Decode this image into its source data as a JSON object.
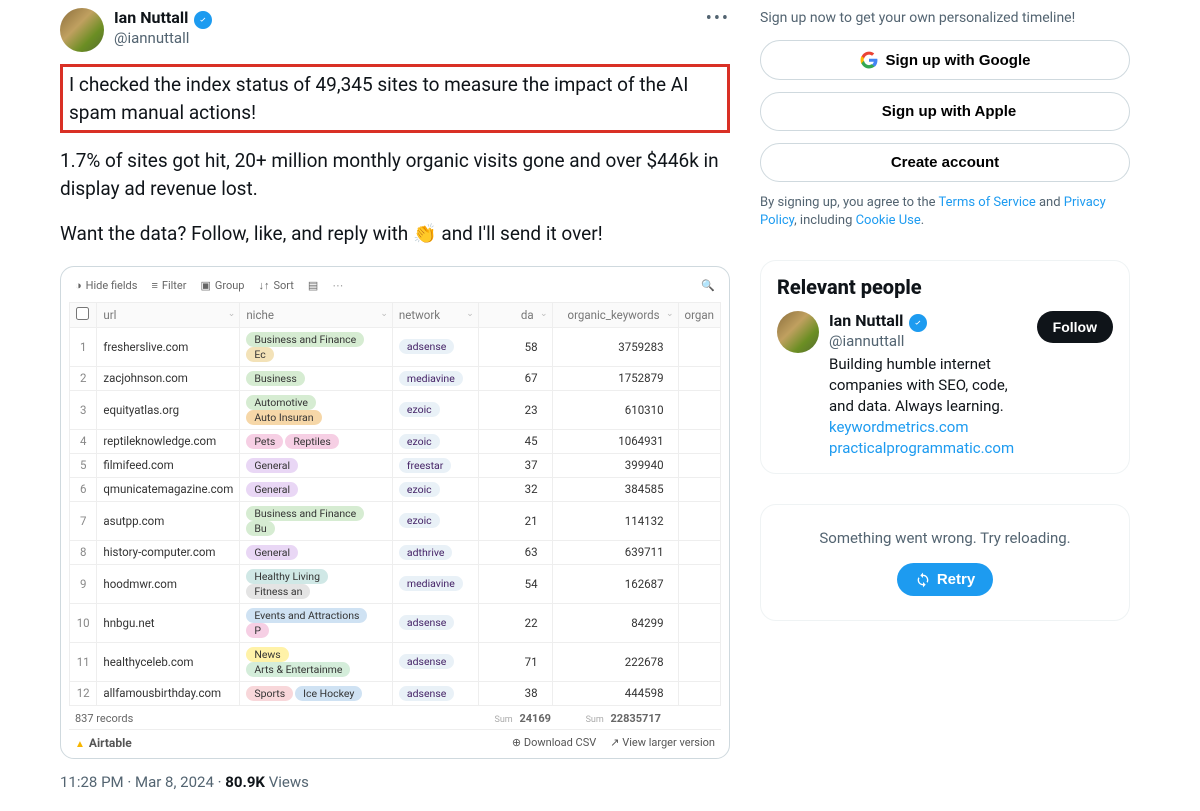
{
  "tweet": {
    "author": {
      "name": "Ian Nuttall",
      "handle": "@iannuttall"
    },
    "para1": "I checked the index status of 49,345 sites to measure the impact of the AI spam manual actions!",
    "para2": "1.7% of sites got hit, 20+ million monthly organic visits gone and over $446k in display ad revenue lost.",
    "para3_pre": "Want the data? Follow, like, and reply with ",
    "emoji": "👏",
    "para3_post": " and I'll send it over!",
    "timestamp": "11:28 PM · Mar 8, 2024",
    "views_count": "80.9K",
    "views_label": " Views"
  },
  "toolbar": {
    "hide": "Hide fields",
    "filter": "Filter",
    "group": "Group",
    "sort": "Sort"
  },
  "headers": {
    "url": "url",
    "niche": "niche",
    "network": "network",
    "da": "da",
    "organic_keywords": "organic_keywords",
    "organic": "organ"
  },
  "rows": [
    {
      "i": "1",
      "url": "fresherslive.com",
      "niches": [
        {
          "t": "Business and Finance",
          "c": "#d6ecd2"
        },
        {
          "t": "Ec",
          "c": "#f3e2b8"
        }
      ],
      "net": "adsense",
      "da": "58",
      "ok": "3759283"
    },
    {
      "i": "2",
      "url": "zacjohnson.com",
      "niches": [
        {
          "t": "Business",
          "c": "#d6ecd2"
        }
      ],
      "net": "mediavine",
      "da": "67",
      "ok": "1752879"
    },
    {
      "i": "3",
      "url": "equityatlas.org",
      "niches": [
        {
          "t": "Automotive",
          "c": "#d6ecd2"
        },
        {
          "t": "Auto Insuran",
          "c": "#f6d7a8"
        }
      ],
      "net": "ezoic",
      "da": "23",
      "ok": "610310"
    },
    {
      "i": "4",
      "url": "reptileknowledge.com",
      "niches": [
        {
          "t": "Pets",
          "c": "#f6cfe4"
        },
        {
          "t": "Reptiles",
          "c": "#f6cfe4"
        }
      ],
      "net": "ezoic",
      "da": "45",
      "ok": "1064931"
    },
    {
      "i": "5",
      "url": "filmifeed.com",
      "niches": [
        {
          "t": "General",
          "c": "#e9d7f5"
        }
      ],
      "net": "freestar",
      "da": "37",
      "ok": "399940"
    },
    {
      "i": "6",
      "url": "qmunicatemagazine.com",
      "niches": [
        {
          "t": "General",
          "c": "#e9d7f5"
        }
      ],
      "net": "ezoic",
      "da": "32",
      "ok": "384585"
    },
    {
      "i": "7",
      "url": "asutpp.com",
      "niches": [
        {
          "t": "Business and Finance",
          "c": "#d6ecd2"
        },
        {
          "t": "Bu",
          "c": "#d6ecd2"
        }
      ],
      "net": "ezoic",
      "da": "21",
      "ok": "114132"
    },
    {
      "i": "8",
      "url": "history-computer.com",
      "niches": [
        {
          "t": "General",
          "c": "#e9d7f5"
        }
      ],
      "net": "adthrive",
      "da": "63",
      "ok": "639711"
    },
    {
      "i": "9",
      "url": "hoodmwr.com",
      "niches": [
        {
          "t": "Healthy Living",
          "c": "#d0e8e6"
        },
        {
          "t": "Fitness an",
          "c": "#e4e4e4"
        }
      ],
      "net": "mediavine",
      "da": "54",
      "ok": "162687"
    },
    {
      "i": "10",
      "url": "hnbgu.net",
      "niches": [
        {
          "t": "Events and Attractions",
          "c": "#cfe2f3"
        },
        {
          "t": "P",
          "c": "#f6cfe4"
        }
      ],
      "net": "adsense",
      "da": "22",
      "ok": "84299"
    },
    {
      "i": "11",
      "url": "healthyceleb.com",
      "niches": [
        {
          "t": "News",
          "c": "#fff2a8"
        },
        {
          "t": "Arts & Entertainme",
          "c": "#d4edda"
        }
      ],
      "net": "adsense",
      "da": "71",
      "ok": "222678"
    },
    {
      "i": "12",
      "url": "allfamousbirthday.com",
      "niches": [
        {
          "t": "Sports",
          "c": "#f8d7da"
        },
        {
          "t": "Ice Hockey",
          "c": "#cfe2f3"
        }
      ],
      "net": "adsense",
      "da": "38",
      "ok": "444598"
    }
  ],
  "footer": {
    "records": "837 records",
    "sum_label": "Sum",
    "sum_da": "24169",
    "sum_ok": "22835717",
    "brand": "Airtable",
    "download": "Download CSV",
    "larger": "View larger version"
  },
  "sidebar": {
    "signup_msg": "Sign up now to get your own personalized timeline!",
    "google": "Sign up with Google",
    "apple": "Sign up with Apple",
    "create": "Create account",
    "disclaimer_pre": "By signing up, you agree to the ",
    "tos": "Terms of Service",
    "disclaimer_and": " and ",
    "pp": "Privacy Policy",
    "disclaimer_inc": ", including ",
    "cookie": "Cookie Use",
    "dot": ".",
    "relevant_title": "Relevant people",
    "person": {
      "name": "Ian Nuttall",
      "handle": "@iannuttall",
      "follow": "Follow",
      "bio": "Building humble internet companies with SEO, code, and data. Always learning. ",
      "link1": "keywordmetrics.com",
      "link2": "practicalprogrammatic.com"
    },
    "error_msg": "Something went wrong. Try reloading.",
    "retry": "Retry"
  }
}
